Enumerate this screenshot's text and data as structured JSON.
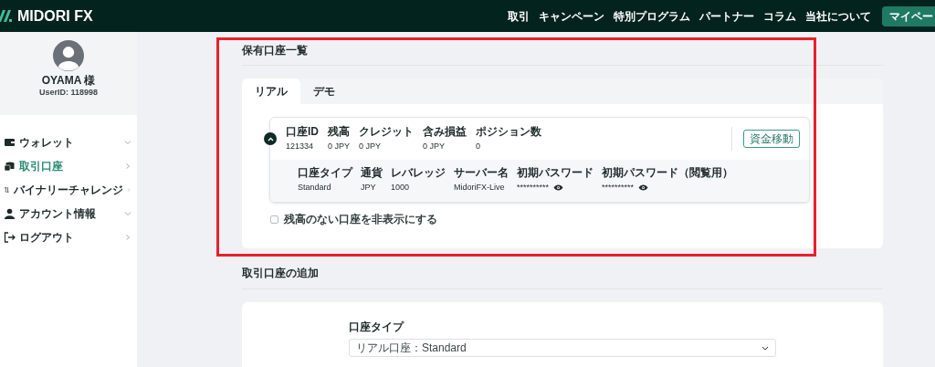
{
  "header": {
    "logo": "MIDORI FX",
    "nav": [
      "取引",
      "キャンペーン",
      "特別プログラム",
      "パートナー",
      "コラム",
      "当社について"
    ],
    "button": "マイペー"
  },
  "profile": {
    "name": "OYAMA 様",
    "user_id": "UserID: 118998"
  },
  "sidebar": {
    "items": [
      {
        "label": "ウォレット",
        "selected": false
      },
      {
        "label": "取引口座",
        "selected": true
      },
      {
        "label": "バイナリーチャレンジ",
        "selected": false
      },
      {
        "label": "アカウント情報",
        "selected": false
      },
      {
        "label": "ログアウト",
        "selected": false
      }
    ]
  },
  "accounts_section": {
    "title": "保有口座一覧",
    "tabs": [
      {
        "label": "リアル",
        "selected": true
      },
      {
        "label": "デモ",
        "selected": false
      }
    ],
    "account": {
      "expanded": true,
      "summary": [
        {
          "label": "口座ID",
          "value": "121334"
        },
        {
          "label": "残高",
          "value": "0 JPY"
        },
        {
          "label": "クレジット",
          "value": "0 JPY"
        },
        {
          "label": "含み損益",
          "value": "0 JPY"
        },
        {
          "label": "ポジション数",
          "value": "0"
        }
      ],
      "transfer_button": "資金移動",
      "details": [
        {
          "label": "口座タイプ",
          "value": "Standard",
          "kind": "text"
        },
        {
          "label": "通貨",
          "value": "JPY",
          "kind": "text"
        },
        {
          "label": "レバレッジ",
          "value": "1000",
          "kind": "text"
        },
        {
          "label": "サーバー名",
          "value": "MidoriFX-Live",
          "kind": "text"
        },
        {
          "label": "初期パスワード",
          "value": "**********",
          "kind": "password"
        },
        {
          "label": "初期パスワード（閲覧用）",
          "value": "**********",
          "kind": "password"
        }
      ]
    },
    "hide_empty": {
      "label": "残高のない口座を非表示にする",
      "checked": false
    }
  },
  "add_section": {
    "title": "取引口座の追加",
    "field_label": "口座タイプ",
    "select_value": "リアル口座：Standard"
  }
}
